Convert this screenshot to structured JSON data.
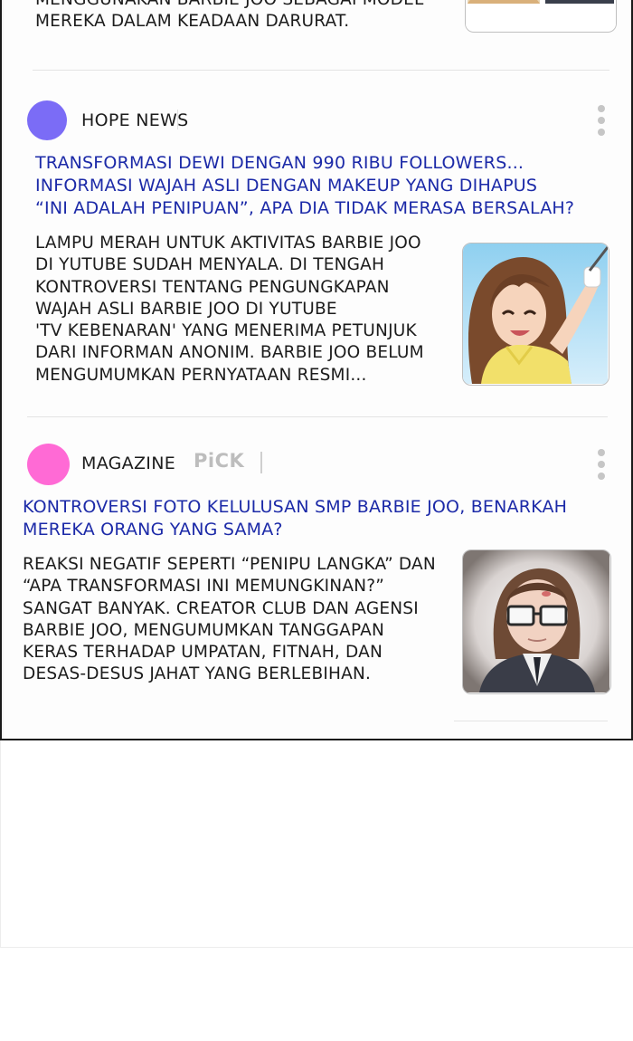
{
  "feed": {
    "top_article": {
      "body": "MENGGUNAKAN BARBIE JOO SEBAGAI MODEL\nMEREKA DALAM KEADAAN DARURAT."
    },
    "articles": [
      {
        "source": "HOPE NEWS",
        "avatar_color": "#7b6cf6",
        "headline": "TRANSFORMASI DEWI DENGAN 990 RIBU FOLLOWERS...\nINFORMASI WAJAH ASLI DENGAN MAKEUP YANG DIHAPUS\n“INI ADALAH PENIPUAN”, APA DIA TIDAK MERASA BERSALAH?",
        "body": "LAMPU MERAH UNTUK AKTIVITAS BARBIE JOO\nDI YUTUBE SUDAH MENYALA. DI TENGAH\nKONTROVERSI TENTANG PENGUNGKAPAN\nWAJAH ASLI BARBIE JOO DI YUTUBE\n'TV KEBENARAN' YANG MENERIMA PETUNJUK\nDARI INFORMAN ANONIM. BARBIE JOO BELUM\nMENGUMUMKAN PERNYATAAN RESMI...",
        "thumbnail_icon": "golfer-woman-illustration"
      },
      {
        "source": "MAGAZINE",
        "badge": "PiCK",
        "avatar_color": "#ff6ad5",
        "headline": "KONTROVERSI FOTO KELULUSAN SMP BARBIE JOO, BENARKAH\nMEREKA ORANG YANG SAMA?",
        "body": "REAKSI NEGATIF SEPERTI “PENIPU LANGKA” DAN\n“APA TRANSFORMASI INI MEMUNGKINAN?”\nSANGAT BANYAK. CREATOR CLUB DAN AGENSI\nBARBIE JOO, MENGUMUMKAN TANGGAPAN\nKERAS TERHADAP UMPATAN, FITNAH, DAN\nDESAS-DESUS JAHAT YANG BERLEBIHAN.",
        "thumbnail_icon": "glasses-student-portrait"
      }
    ]
  },
  "colors": {
    "headline": "#1c2aa8",
    "body_text": "#1c1c1c",
    "divider": "#e4e4e4"
  }
}
